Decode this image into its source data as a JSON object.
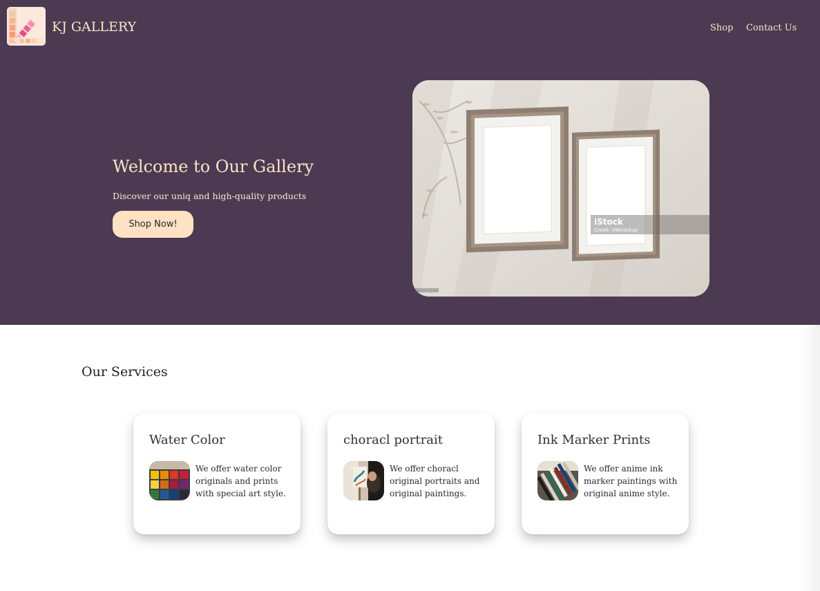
{
  "header": {
    "brand": "KJ GALLERY",
    "logo_icon": "color-swatch-logo-icon",
    "nav": [
      {
        "label": "Shop"
      },
      {
        "label": "Contact Us"
      }
    ]
  },
  "hero": {
    "title": "Welcome to Our Gallery",
    "subtitle": "Discover our uniq and high-quality products",
    "button_label": "Shop Now!",
    "image": {
      "watermark": "iStock",
      "credit": "Credit: VNmockup"
    }
  },
  "services": {
    "title": "Our Services",
    "cards": [
      {
        "title": "Water Color",
        "text": "We offer water color originals and prints with special art style.",
        "thumb_icon": "watercolor-palette-thumb"
      },
      {
        "title": "choracl portrait",
        "text": "We offer choracl original portraits and original paintings.",
        "thumb_icon": "painter-easel-thumb"
      },
      {
        "title": "Ink Marker Prints",
        "text": "We offer anime ink marker paintings with original anime style.",
        "thumb_icon": "ink-markers-thumb"
      }
    ]
  },
  "colors": {
    "hero_bg": "#4b3a52",
    "accent": "#ffe2c4",
    "card_bg": "#ffffff"
  }
}
